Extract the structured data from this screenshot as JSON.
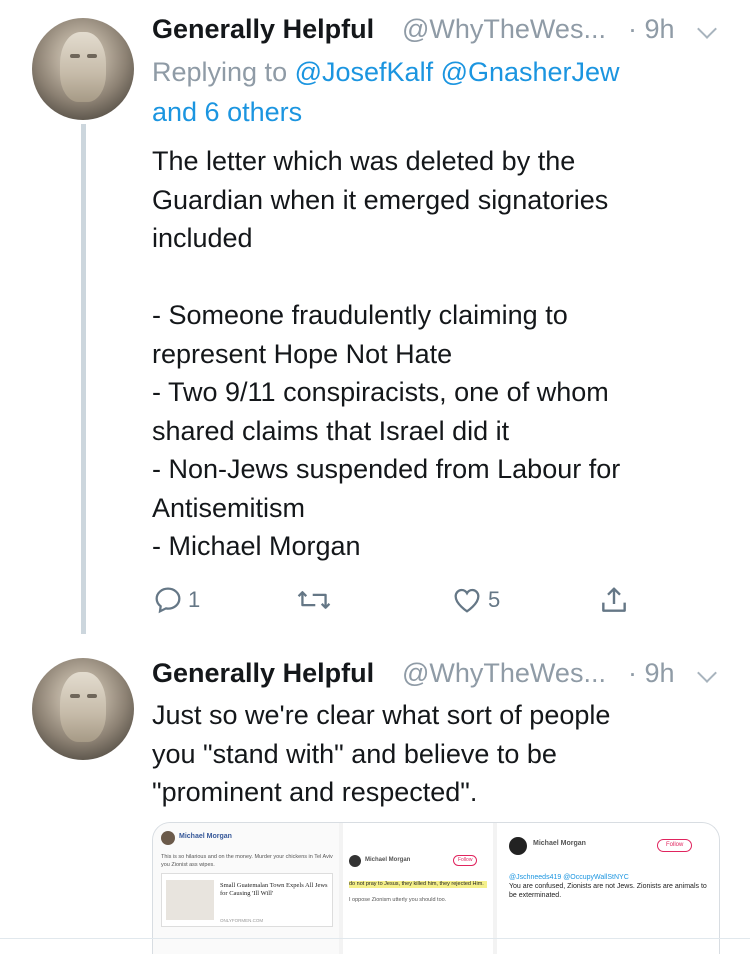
{
  "tweets": [
    {
      "name": "Generally Helpful",
      "handle": "@WhyTheWes...",
      "time": "· 9h",
      "reply_prefix": "Replying to",
      "reply_users": "@JosefKalf @GnasherJew",
      "reply_others": "and 6 others",
      "lines": [
        "The letter which was deleted by the",
        "Guardian when it emerged signatories",
        "included",
        "",
        "- Someone fraudulently claiming to",
        "represent Hope Not Hate",
        "- Two 9/11 conspiracists, one of whom",
        "shared claims that Israel did it",
        "- Non-Jews suspended from Labour for",
        "Antisemitism",
        "- Michael Morgan"
      ],
      "actions": {
        "reply_count": "1",
        "retweet_count": "",
        "like_count": "5"
      },
      "icons": [
        "reply-icon",
        "retweet-icon",
        "like-icon",
        "share-icon",
        "chevron-down-icon"
      ]
    },
    {
      "name": "Generally Helpful",
      "handle": "@WhyTheWes...",
      "time": "· 9h",
      "lines": [
        "Just so we're clear what sort of people",
        "you \"stand with\" and believe to be",
        "\"prominent and respected\"."
      ],
      "media": {
        "panel1": {
          "author": "Michael Morgan",
          "text1": "This is so hilarious and on the money. Murder your chickens in Tel Aviv",
          "text2": "you Zionist ass wipes.",
          "card_title": "Small Guatemalan Town Expels All Jews for Causing 'Ill Will'",
          "card_domain": "ONLYFORMEN.COM"
        },
        "panel2": {
          "author": "Michael Morgan",
          "follow": "Follow",
          "highlight": "do not pray to Jesus, they killed him, they rejected Him.",
          "text": "I oppose Zionism utterly you should too."
        },
        "panel3": {
          "author": "Michael Morgan",
          "follow": "Follow",
          "mentions": "@Jschneeds419 @OccupyWallStNYC",
          "text": "You are confused, Zionists are not Jews. Zionists are animals to be exterminated."
        }
      }
    }
  ],
  "colors": {
    "link": "#1b95e0",
    "secondary_text": "#8f9ba6",
    "thread_line": "#ccd6dd"
  }
}
